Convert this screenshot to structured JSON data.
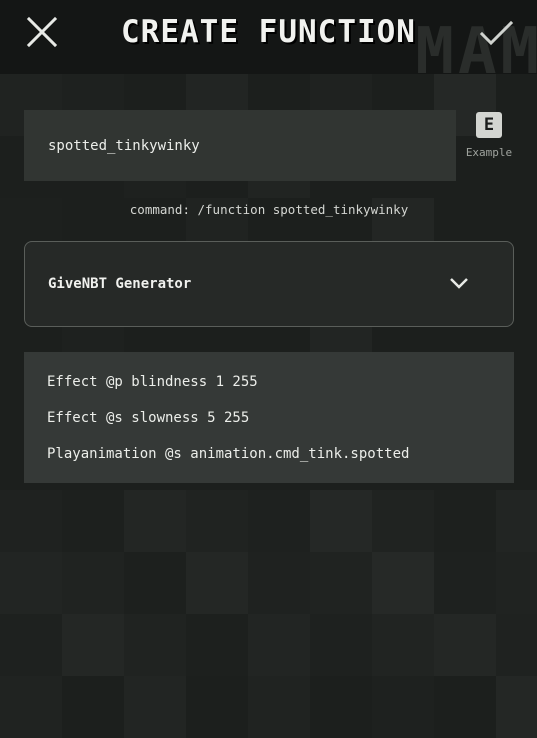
{
  "header": {
    "title": "CREATE FUNCTION",
    "watermark": "MAM",
    "close_icon": "close-icon",
    "confirm_icon": "checkmark-icon"
  },
  "name_input": {
    "value": "spotted_tinkywinky"
  },
  "example": {
    "key": "E",
    "label": "Example"
  },
  "command_preview": "command: /function spotted_tinkywinky",
  "generator_dropdown": {
    "selected": "GiveNBT Generator",
    "icon": "chevron-down-icon"
  },
  "commands": [
    "Effect @p blindness 1 255",
    "Effect @s slowness 5 255",
    "Playanimation @s animation.cmd_tink.spotted"
  ],
  "colors": {
    "background": "#1c1f1d",
    "header": "#141615",
    "field": "#313532",
    "commands_box": "#353937",
    "text": "#eceeea"
  }
}
